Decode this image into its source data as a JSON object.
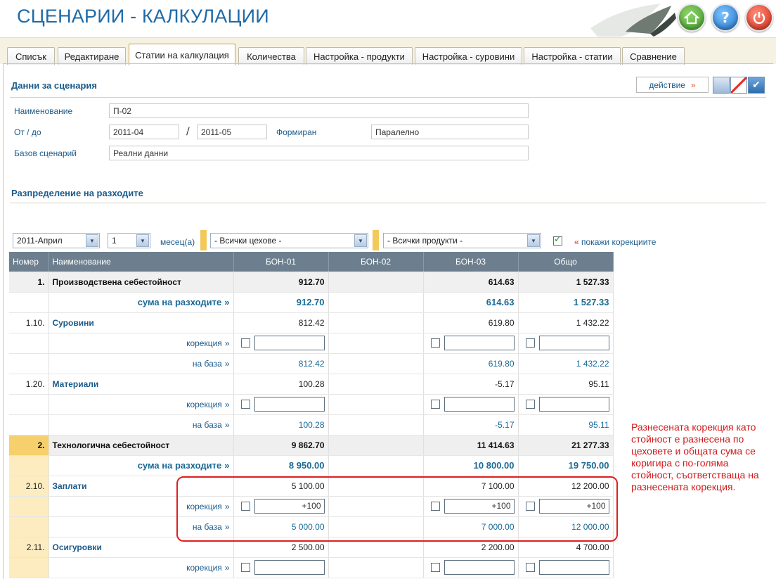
{
  "app": {
    "title": "СЦЕНАРИИ - КАЛКУЛАЦИИ"
  },
  "tabs": [
    {
      "label": "Списък"
    },
    {
      "label": "Редактиране"
    },
    {
      "label": "Статии на калкулация",
      "active": true
    },
    {
      "label": "Количества"
    },
    {
      "label": "Настройка - продукти"
    },
    {
      "label": "Настройка - суровини"
    },
    {
      "label": "Настройка - статии"
    },
    {
      "label": "Сравнение"
    }
  ],
  "scenario": {
    "title": "Данни за сценария",
    "action_label": "действие",
    "name_label": "Наименование",
    "name_value": "П-02",
    "period_label": "От / до",
    "from_value": "2011-04",
    "to_value": "2011-05",
    "formed_label": "Формиран",
    "formed_value": "Паралелно",
    "base_label": "Базов сценарий",
    "base_value": "Реални данни"
  },
  "distribution": {
    "title": "Разпределение на разходите",
    "month_select": "2011-Април",
    "count_select": "1",
    "months_label": "месец(а)",
    "workshop_select": "- Всички цехове -",
    "products_select": "- Всички продукти -",
    "show_corrections_label": "покажи корекциите",
    "show_corrections_checked": true
  },
  "table": {
    "headers": [
      "Номер",
      "Наименование",
      "БОН-01",
      "БОН-02",
      "БОН-03",
      "Общо"
    ],
    "sum_label": "сума на разходите",
    "correction_label": "корекция",
    "base_label": "на база",
    "groups": [
      {
        "num": "1.",
        "name": "Производствена себестойност",
        "values": [
          "912.70",
          "",
          "614.63",
          "1 527.33"
        ],
        "sum": [
          "912.70",
          "",
          "614.63",
          "1 527.33"
        ],
        "items": [
          {
            "num": "1.10.",
            "name": "Суровини",
            "values": [
              "812.42",
              "",
              "619.80",
              "1 432.22"
            ],
            "corrections": [
              "",
              "",
              ""
            ],
            "base": [
              "812.42",
              "",
              "619.80",
              "1 432.22"
            ]
          },
          {
            "num": "1.20.",
            "name": "Материали",
            "values": [
              "100.28",
              "",
              "-5.17",
              "95.11"
            ],
            "corrections": [
              "",
              "",
              ""
            ],
            "base": [
              "100.28",
              "",
              "-5.17",
              "95.11"
            ]
          }
        ]
      },
      {
        "num": "2.",
        "name": "Технологична себестойност",
        "values": [
          "9 862.70",
          "",
          "11 414.63",
          "21 277.33"
        ],
        "sum": [
          "8 950.00",
          "",
          "10 800.00",
          "19 750.00"
        ],
        "items": [
          {
            "num": "2.10.",
            "name": "Заплати",
            "values": [
              "5 100.00",
              "",
              "7 100.00",
              "12 200.00"
            ],
            "corrections": [
              "+100",
              "+100",
              "+100"
            ],
            "base": [
              "5 000.00",
              "",
              "7 000.00",
              "12 000.00"
            ]
          },
          {
            "num": "2.11.",
            "name": "Осигуровки",
            "values": [
              "2 500.00",
              "",
              "2 200.00",
              "4 700.00"
            ],
            "corrections": [
              "",
              "",
              ""
            ],
            "base": []
          }
        ]
      }
    ]
  },
  "annotation": {
    "text": "Разнесената корекция като стойност е разнесена по цеховете и общата сума се коригира с по-голяма стойност, съответстваща на разнесената корекция."
  },
  "colors": {
    "accent": "#1e6aa7",
    "header_row": "#6d7f8e",
    "highlight": "#f6d06d",
    "annotation": "#e02020"
  }
}
